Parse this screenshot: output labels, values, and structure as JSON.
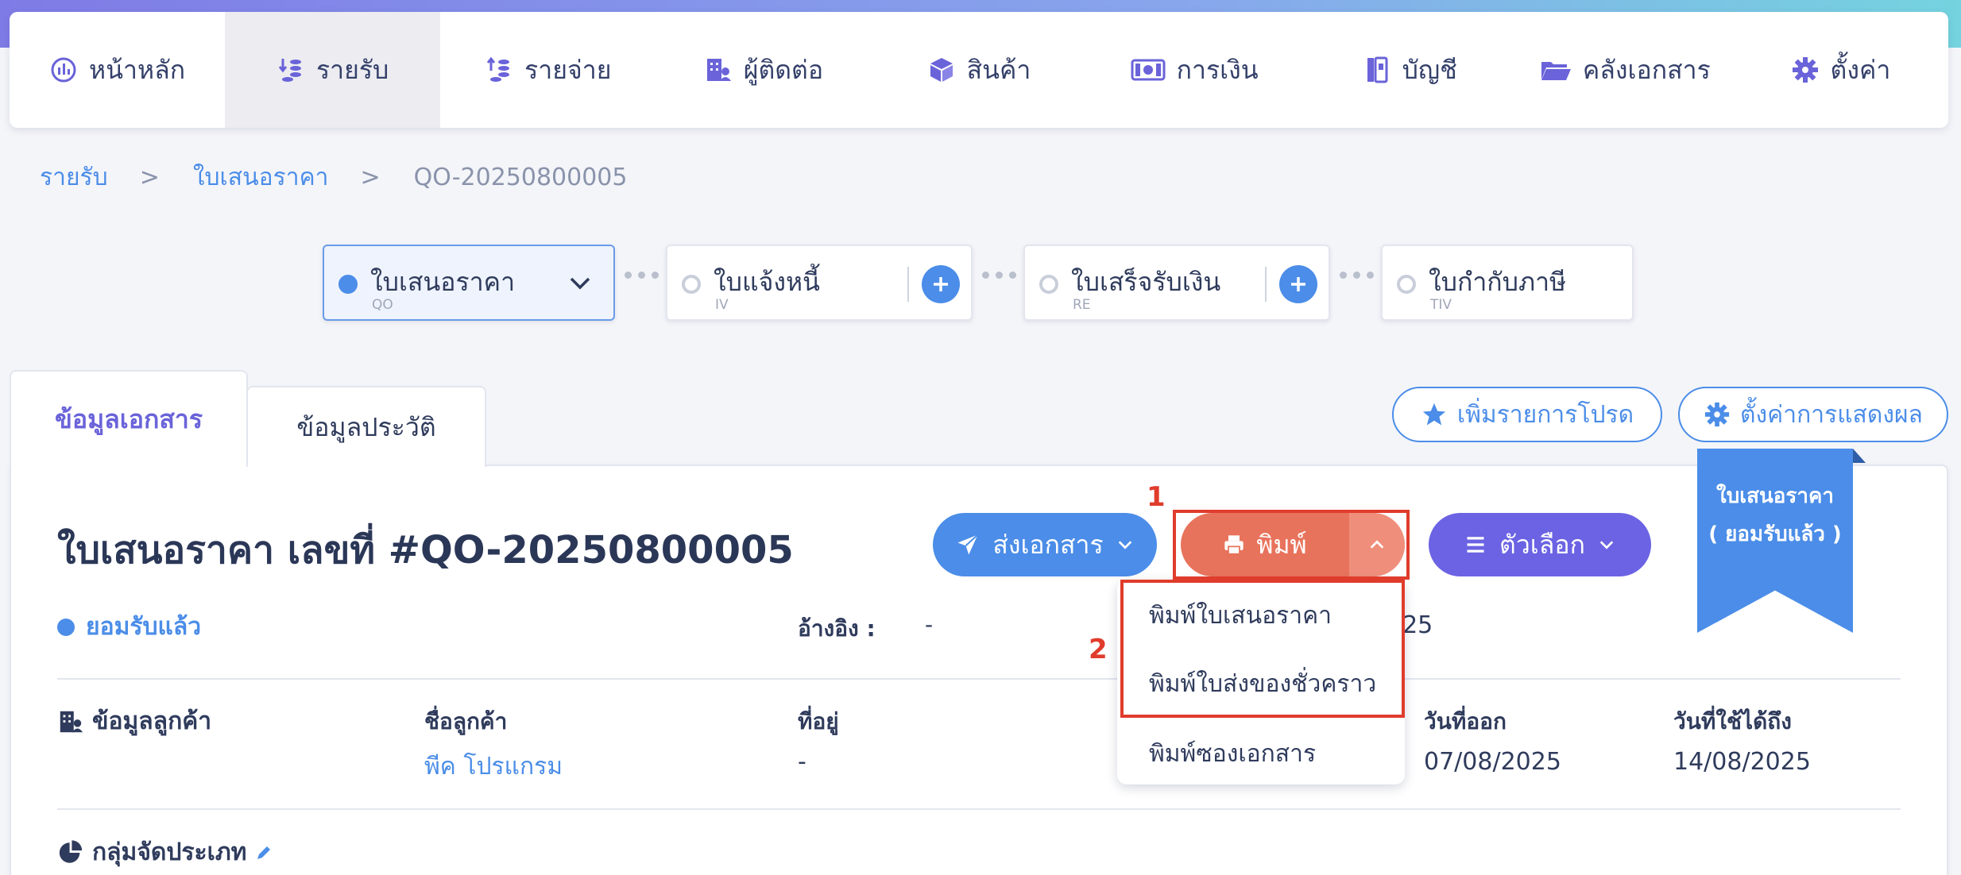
{
  "nav": {
    "items": [
      {
        "label": "หน้าหลัก",
        "icon": "chart-icon"
      },
      {
        "label": "รายรับ",
        "icon": "income-icon"
      },
      {
        "label": "รายจ่าย",
        "icon": "expense-icon"
      },
      {
        "label": "ผู้ติดต่อ",
        "icon": "contacts-icon"
      },
      {
        "label": "สินค้า",
        "icon": "box-icon"
      },
      {
        "label": "การเงิน",
        "icon": "money-icon"
      },
      {
        "label": "บัญชี",
        "icon": "ledger-icon"
      },
      {
        "label": "คลังเอกสาร",
        "icon": "folder-icon"
      },
      {
        "label": "ตั้งค่า",
        "icon": "gear-icon"
      }
    ],
    "active_index": 1
  },
  "breadcrumb": {
    "level1": "รายรับ",
    "level2": "ใบเสนอราคา",
    "current": "QO-20250800005",
    "separator": ">"
  },
  "doc_flow": [
    {
      "title": "ใบเสนอราคา",
      "code": "QO"
    },
    {
      "title": "ใบแจ้งหนี้",
      "code": "IV"
    },
    {
      "title": "ใบเสร็จรับเงิน",
      "code": "RE"
    },
    {
      "title": "ใบกำกับภาษี",
      "code": "TIV"
    }
  ],
  "tabs": {
    "document_info": "ข้อมูลเอกสาร",
    "history": "ข้อมูลประวัติ"
  },
  "toolbar": {
    "favorite_label": "เพิ่มรายการโปรด",
    "display_settings_label": "ตั้งค่าการแสดงผล",
    "send_label": "ส่งเอกสาร",
    "print_label": "พิมพ์",
    "options_label": "ตัวเลือก"
  },
  "document": {
    "title": "ใบเสนอราคา เลขที่ #QO-20250800005",
    "status": "ยอมรับแล้ว",
    "ribbon_line1": "ใบเสนอราคา",
    "ribbon_line2": "( ยอมรับแล้ว )",
    "reference_label": "อ้างอิง :",
    "reference_value": "-",
    "date_partial": "025"
  },
  "customer": {
    "section_title": "ข้อมูลลูกค้า",
    "name_label": "ชื่อลูกค้า",
    "name_value": "พีค โปรแกรม",
    "address_label": "ที่อยู่",
    "address_value": "-",
    "issue_date_label": "วันที่ออก",
    "issue_date_value": "07/08/2025",
    "valid_until_label": "วันที่ใช้ได้ถึง",
    "valid_until_value": "14/08/2025"
  },
  "category": {
    "section_title": "กลุ่มจัดประเภท"
  },
  "print_menu": {
    "items": [
      "พิมพ์ใบเสนอราคา",
      "พิมพ์ใบส่งของชั่วคราว",
      "พิมพ์ซองเอกสาร"
    ]
  },
  "annotations": {
    "step1": "1",
    "step2": "2"
  },
  "colors": {
    "accent_blue": "#4b8de8",
    "print_orange": "#e8735c",
    "options_purple": "#6b63e3",
    "annotation_red": "#e03c2c"
  }
}
